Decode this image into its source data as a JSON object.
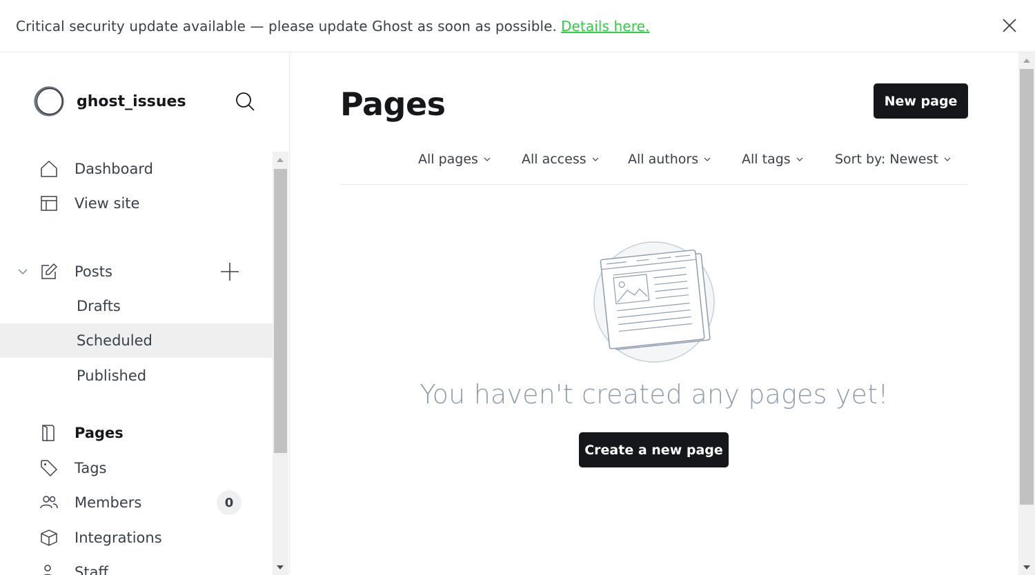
{
  "banner": {
    "text": "Critical security update available — please update Ghost as soon as possible.",
    "link": "Details here."
  },
  "brand": {
    "name": "ghost_issues"
  },
  "sidebar": {
    "items": [
      {
        "label": "Dashboard",
        "icon": "home-icon"
      },
      {
        "label": "View site",
        "icon": "layout-icon"
      },
      {
        "label": "Posts",
        "icon": "edit-icon"
      },
      {
        "label": "Drafts"
      },
      {
        "label": "Scheduled"
      },
      {
        "label": "Published"
      },
      {
        "label": "Pages",
        "icon": "page-icon"
      },
      {
        "label": "Tags",
        "icon": "tag-icon"
      },
      {
        "label": "Members",
        "icon": "members-icon",
        "badge": "0"
      },
      {
        "label": "Integrations",
        "icon": "cube-icon"
      },
      {
        "label": "Staff",
        "icon": "staff-icon"
      }
    ]
  },
  "main": {
    "title": "Pages",
    "new_button": "New page",
    "filters": [
      "All pages",
      "All access",
      "All authors",
      "All tags",
      "Sort by: Newest"
    ],
    "empty_text": "You haven't created any pages yet!",
    "create_button": "Create a new page"
  },
  "colors": {
    "accent_link": "#30cf43",
    "primary": "#15171a",
    "muted": "#8e9cac"
  }
}
